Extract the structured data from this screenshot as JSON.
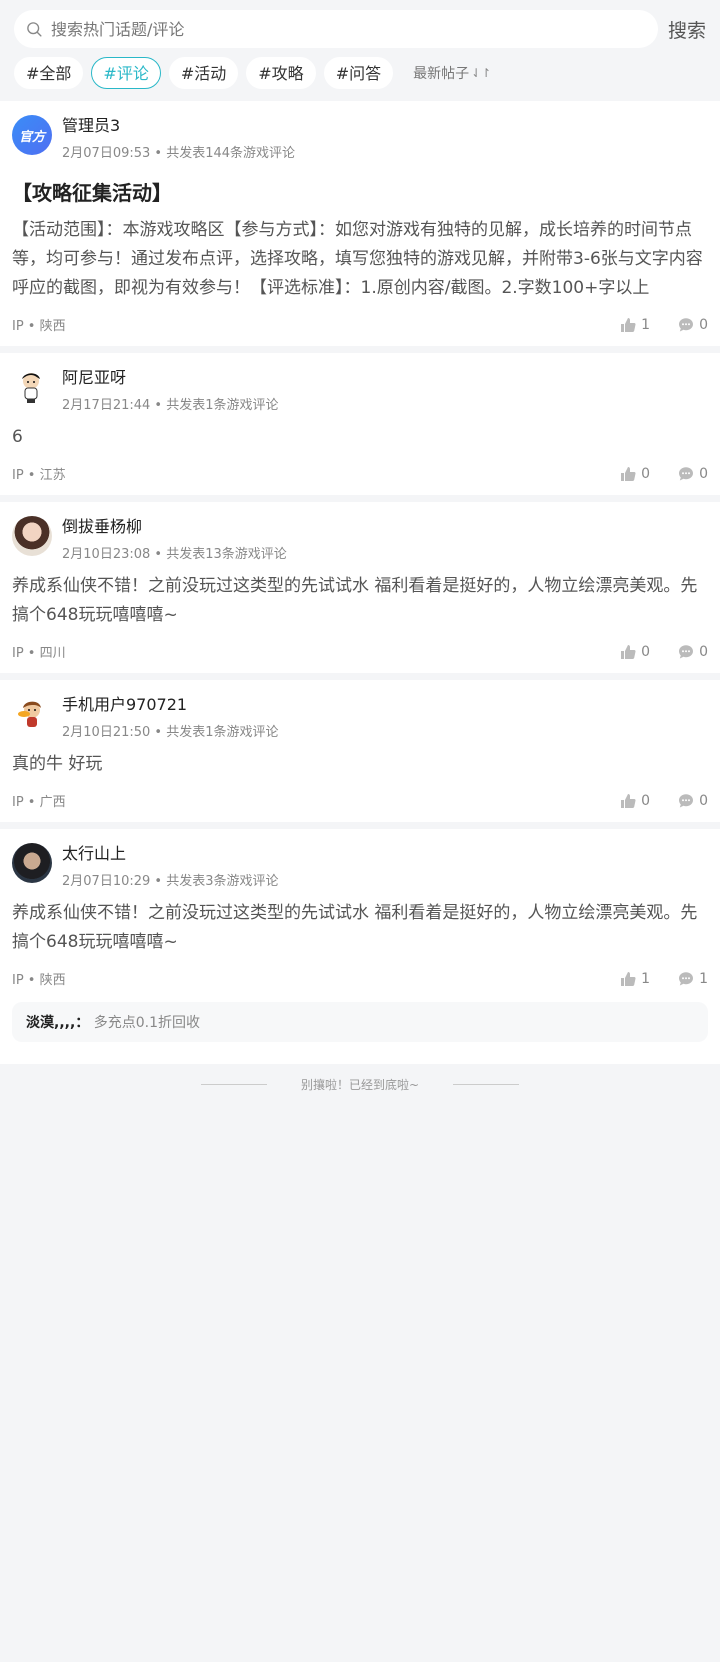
{
  "search": {
    "placeholder": "搜索热门话题/评论",
    "button_label": "搜索"
  },
  "tags": [
    {
      "label": "#全部",
      "active": false
    },
    {
      "label": "#评论",
      "active": true
    },
    {
      "label": "#活动",
      "active": false
    },
    {
      "label": "#攻略",
      "active": false
    },
    {
      "label": "#问答",
      "active": false
    }
  ],
  "sort": {
    "label": "最新帖子",
    "icon": "sort-arrows-icon"
  },
  "posts": [
    {
      "avatar_text": "官方",
      "name": "管理员3",
      "sub": "2月07日09:53 • 共发表144条游戏评论",
      "title": "【攻略征集活动】",
      "body": "【活动范围】：本游戏攻略区【参与方式】：如您对游戏有独特的见解，成长培养的时间节点等，均可参与！通过发布点评，选择攻略，填写您独特的游戏见解，并附带3-6张与文字内容呼应的截图，即视为有效参与！【评选标准】：1.原创内容/截图。2.字数100+字以上",
      "ip": "IP • 陕西",
      "likes": "1",
      "comments": "0"
    },
    {
      "name": "阿尼亚呀",
      "sub": "2月17日21:44 • 共发表1条游戏评论",
      "body": "6",
      "ip": "IP • 江苏",
      "likes": "0",
      "comments": "0"
    },
    {
      "name": "倒拔垂杨柳",
      "sub": "2月10日23:08 • 共发表13条游戏评论",
      "body": "养成系仙侠不错！之前没玩过这类型的先试试水 福利看着是挺好的，人物立绘漂亮美观。先搞个648玩玩嘻嘻嘻~",
      "ip": "IP • 四川",
      "likes": "0",
      "comments": "0"
    },
    {
      "name": "手机用户970721",
      "sub": "2月10日21:50 • 共发表1条游戏评论",
      "body": "真的牛 好玩",
      "ip": "IP • 广西",
      "likes": "0",
      "comments": "0"
    },
    {
      "name": "太行山上",
      "sub": "2月07日10:29 • 共发表3条游戏评论",
      "body": "养成系仙侠不错！之前没玩过这类型的先试试水 福利看着是挺好的，人物立绘漂亮美观。先搞个648玩玩嘻嘻嘻~",
      "ip": "IP • 陕西",
      "likes": "1",
      "comments": "1",
      "reply": {
        "user": "淡漠,,,,：",
        "text": "多充点0.1折回收"
      }
    }
  ],
  "footer": "别攘啦！已经到底啦~",
  "colors": {
    "accent": "#2ab8c8",
    "official_avatar": "#3a8df7"
  }
}
